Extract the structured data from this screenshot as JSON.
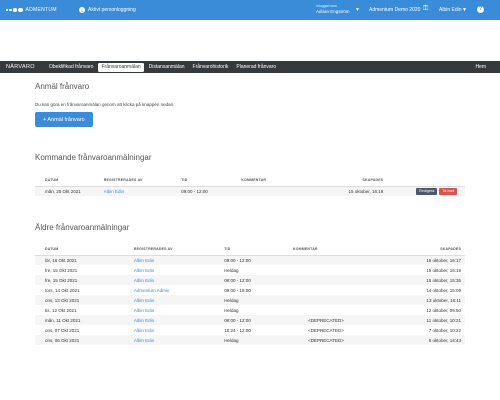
{
  "topbar": {
    "brand": "ADMENTUM",
    "personal_log": "Aktivt personloggning",
    "user1_role": "Inloggad som",
    "user1_name": "Adrian Engström",
    "school": "Admentum Demo 2020",
    "user2_name": "Albin Edin"
  },
  "nav": {
    "module": "NÄRVARO",
    "tabs": [
      "Obeklifikad frånvaro",
      "Frånvaroanmälan",
      "Distansanmälan",
      "Frånvarohistorik",
      "Planerad frånvaro"
    ],
    "active_tab": 1,
    "home": "Hem"
  },
  "report": {
    "title": "Anmäl frånvaro",
    "intro": "Du kan göra en frånvaroanmälan genom att klicka på knappen nedan.",
    "button": "+ Anmäl frånvaro"
  },
  "upcoming": {
    "title": "Kommande frånvaroanmälningar",
    "headers": [
      "DATUM",
      "REGISTRERADES AV",
      "TID",
      "KOMMENTAR",
      "SKAPADES",
      ""
    ],
    "rows": [
      {
        "date": "mån, 25 Okt 2021",
        "by": "Albin Edin",
        "time": "09:00 - 12:00",
        "comment": "",
        "created": "15 oktober, 16:18",
        "edit": "Redigera",
        "delete": "Ta bort"
      }
    ]
  },
  "old": {
    "title": "Äldre frånvaroanmälningar",
    "headers": [
      "DATUM",
      "REGISTRERADES AV",
      "TID",
      "KOMMENTAR",
      "SKAPADES"
    ],
    "rows": [
      {
        "date": "lör, 16 Okt 2021",
        "by": "Albin Edin",
        "time": "09:00 - 12:00",
        "comment": "",
        "created": "15 oktober, 16:17"
      },
      {
        "date": "fre, 15 Okt 2021",
        "by": "Albin Edin",
        "time": "Heldag",
        "comment": "",
        "created": "15 oktober, 16:19"
      },
      {
        "date": "fre, 15 Okt 2021",
        "by": "Albin Edin",
        "time": "09:00 - 12:00",
        "comment": "",
        "created": "15 oktober, 15:35"
      },
      {
        "date": "tors, 14 Okt 2021",
        "by": "Admentum Admin",
        "time": "09:00 - 18:00",
        "comment": "",
        "created": "14 oktober, 15:09"
      },
      {
        "date": "ons, 13 Okt 2021",
        "by": "Albin Edin",
        "time": "Heldag",
        "comment": "",
        "created": "13 oktober, 16:11"
      },
      {
        "date": "tis, 12 Okt 2021",
        "by": "Albin Edin",
        "time": "Heldag",
        "comment": "",
        "created": "12 oktober, 09:50"
      },
      {
        "date": "mån, 11 Okt 2021",
        "by": "Albin Edin",
        "time": "09:00 - 12:00",
        "comment": "<DEPRECATED>",
        "created": "11 oktober, 10:21"
      },
      {
        "date": "ons, 07 Okt 2021",
        "by": "Albin Edin",
        "time": "10:24 - 12:00",
        "comment": "<DEPRECATED>",
        "created": "7 oktober, 10:22"
      },
      {
        "date": "ons, 06 Okt 2021",
        "by": "Albin Edin",
        "time": "Heldag",
        "comment": "<DEPRECATED>",
        "created": "6 oktober, 14:43"
      }
    ]
  },
  "colors": {
    "primary": "#3a8bd8",
    "navbar": "#343a40",
    "danger": "#d9534f",
    "edit": "#4a5a6a"
  },
  "icons": {
    "help": "question-circle",
    "key": "key",
    "chevron": "chevron-down",
    "info": "info-circle"
  }
}
